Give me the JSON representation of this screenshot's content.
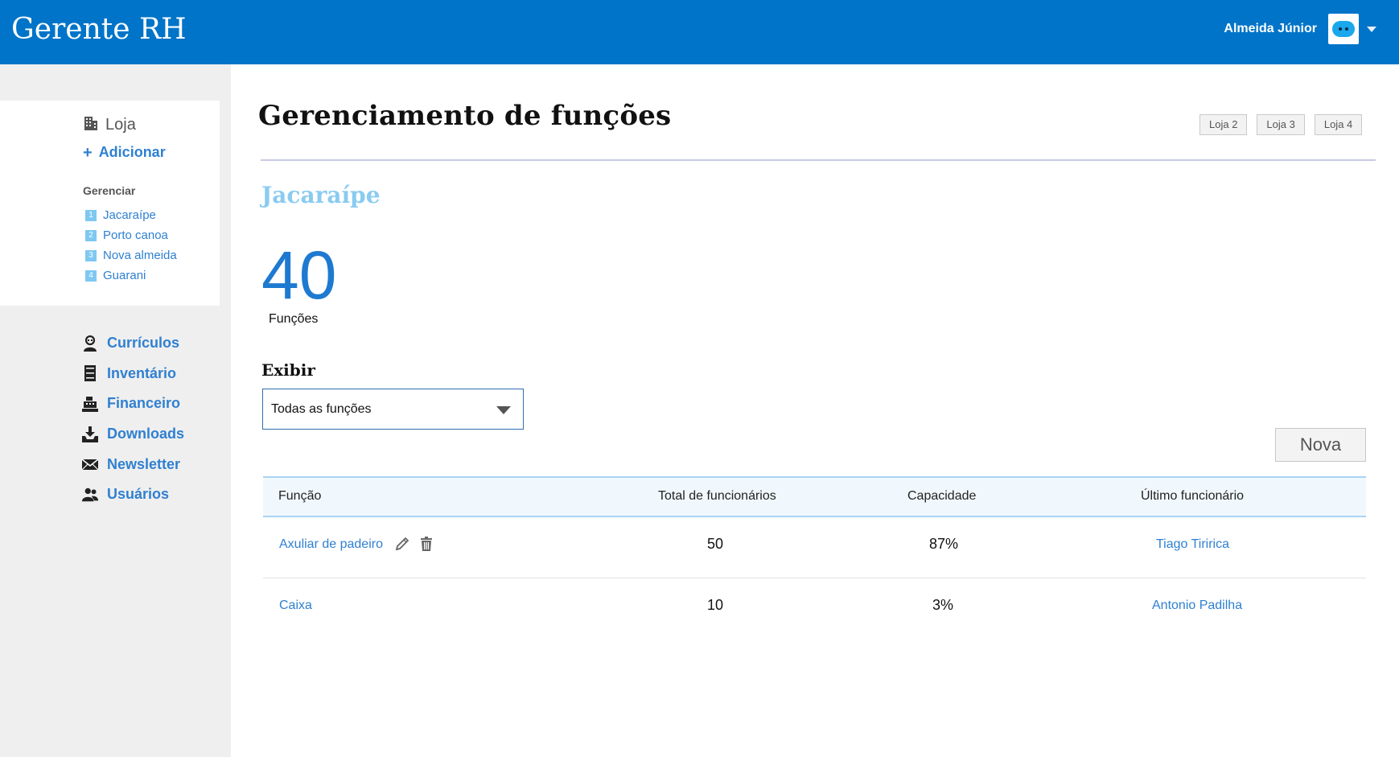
{
  "app": {
    "title": "Gerente RH"
  },
  "user": {
    "name": "Almeida Júnior"
  },
  "sidebar": {
    "store_label": "Loja",
    "add_label": "Adicionar",
    "manage_label": "Gerenciar",
    "stores": [
      {
        "num": "1",
        "label": "Jacaraípe"
      },
      {
        "num": "2",
        "label": "Porto canoa"
      },
      {
        "num": "3",
        "label": "Nova almeida"
      },
      {
        "num": "4",
        "label": "Guarani"
      }
    ],
    "nav": [
      {
        "label": "Currículos",
        "icon": "resume-person-icon"
      },
      {
        "label": "Inventário",
        "icon": "inventory-cabinet-icon"
      },
      {
        "label": "Financeiro",
        "icon": "cash-register-icon"
      },
      {
        "label": "Downloads",
        "icon": "download-tray-icon"
      },
      {
        "label": "Newsletter",
        "icon": "envelope-icon"
      },
      {
        "label": "Usuários",
        "icon": "users-icon"
      }
    ]
  },
  "main": {
    "title": "Gerenciamento de funções",
    "tabs": [
      "Loja 2",
      "Loja 3",
      "Loja 4"
    ],
    "store_name": "Jacaraípe",
    "count_value": "40",
    "count_label": "Funções",
    "filter_label": "Exibir",
    "filter_value": "Todas as funções",
    "new_button": "Nova"
  },
  "table": {
    "headers": [
      "Função",
      "Total de funcionários",
      "Capacidade",
      "Último funcionário"
    ],
    "rows": [
      {
        "function": "Axuliar de padeiro",
        "total": "50",
        "capacity": "87%",
        "last": "Tiago Tiririca"
      },
      {
        "function": "Caixa",
        "total": "10",
        "capacity": "3%",
        "last": "Antonio Padilha"
      }
    ]
  },
  "colors": {
    "header": "#0074c8",
    "accent": "#2f80d1",
    "subtitle": "#8acbf1",
    "sidebar_bg": "#efefef"
  }
}
